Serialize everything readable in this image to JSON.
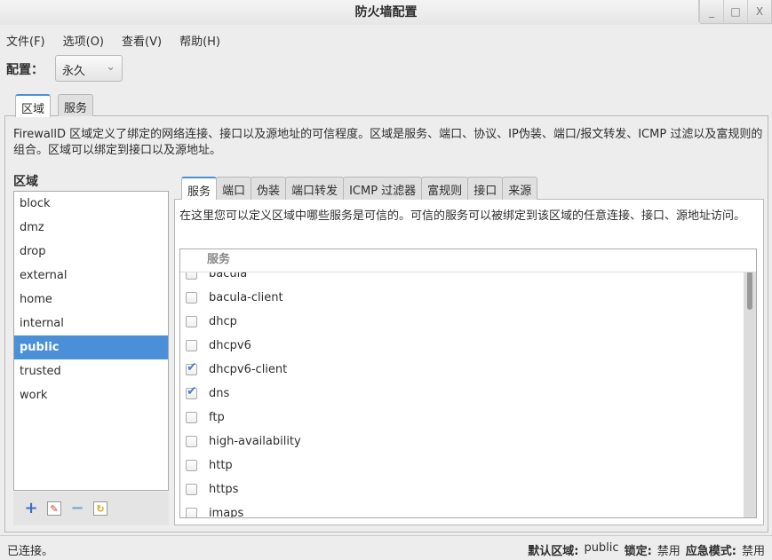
{
  "window": {
    "title": "防火墙配置",
    "min": "_",
    "max": "□",
    "close": "X"
  },
  "menu": [
    "文件(F)",
    "选项(O)",
    "查看(V)",
    "帮助(H)"
  ],
  "config": {
    "label": "配置：",
    "value": "永久"
  },
  "outer_tabs": [
    "区域",
    "服务"
  ],
  "description": "FirewallD 区域定义了绑定的网络连接、接口以及源地址的可信程度。区域是服务、端口、协议、IP伪装、端口/报文转发、ICMP 过滤以及富规则的组合。区域可以绑定到接口以及源地址。",
  "zones": {
    "label": "区域",
    "items": [
      "block",
      "dmz",
      "drop",
      "external",
      "home",
      "internal",
      "public",
      "trusted",
      "work"
    ],
    "selected": "public"
  },
  "zone_tools": [
    "add-icon",
    "edit-icon",
    "remove-icon",
    "load-defaults-icon"
  ],
  "inner_tabs": [
    "服务",
    "端口",
    "伪装",
    "端口转发",
    "ICMP 过滤器",
    "富规则",
    "接口",
    "来源"
  ],
  "services": {
    "description": "在这里您可以定义区域中哪些服务是可信的。可信的服务可以被绑定到该区域的任意连接、接口、源地址访问。",
    "header": "服务",
    "items": [
      {
        "name": "bacula",
        "checked": false
      },
      {
        "name": "bacula-client",
        "checked": false
      },
      {
        "name": "dhcp",
        "checked": false
      },
      {
        "name": "dhcpv6",
        "checked": false
      },
      {
        "name": "dhcpv6-client",
        "checked": true
      },
      {
        "name": "dns",
        "checked": true
      },
      {
        "name": "ftp",
        "checked": false
      },
      {
        "name": "high-availability",
        "checked": false
      },
      {
        "name": "http",
        "checked": false
      },
      {
        "name": "https",
        "checked": false
      },
      {
        "name": "imaps",
        "checked": false
      }
    ]
  },
  "status": {
    "left": "已连接。",
    "default_zone_label": "默认区域:",
    "default_zone": "public",
    "lock_label": "锁定:",
    "lock": "禁用",
    "panic_label": "应急模式:",
    "panic": "禁用"
  }
}
